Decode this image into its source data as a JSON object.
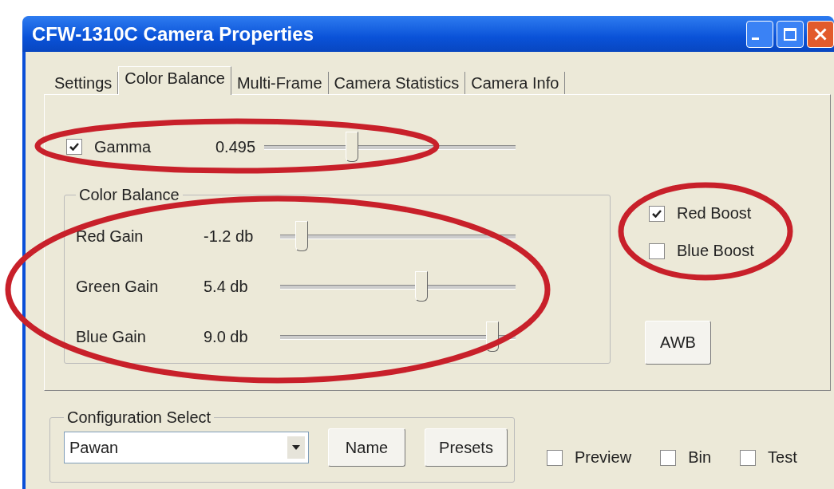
{
  "window": {
    "title": "CFW-1310C Camera Properties"
  },
  "tabs": [
    {
      "label": "Settings",
      "selected": false
    },
    {
      "label": "Color Balance",
      "selected": true
    },
    {
      "label": "Multi-Frame",
      "selected": false
    },
    {
      "label": "Camera Statistics",
      "selected": false
    },
    {
      "label": "Camera Info",
      "selected": false
    }
  ],
  "gamma": {
    "label": "Gamma",
    "checked": true,
    "value": "0.495",
    "level": 0.35
  },
  "color_balance": {
    "title": "Color Balance",
    "gains": [
      {
        "label": "Red Gain",
        "value": "-1.2 db",
        "level": 0.09
      },
      {
        "label": "Green Gain",
        "value": "5.4 db",
        "level": 0.6
      },
      {
        "label": "Blue Gain",
        "value": "9.0 db",
        "level": 0.9
      }
    ]
  },
  "boosts": [
    {
      "label": "Red Boost",
      "checked": true
    },
    {
      "label": "Blue Boost",
      "checked": false
    }
  ],
  "awb_button": "AWB",
  "configuration": {
    "title": "Configuration Select",
    "value": "Pawan",
    "buttons": [
      "Name",
      "Presets"
    ]
  },
  "options": [
    {
      "label": "Preview",
      "checked": false
    },
    {
      "label": "Bin",
      "checked": false
    },
    {
      "label": "Test",
      "checked": false
    }
  ]
}
